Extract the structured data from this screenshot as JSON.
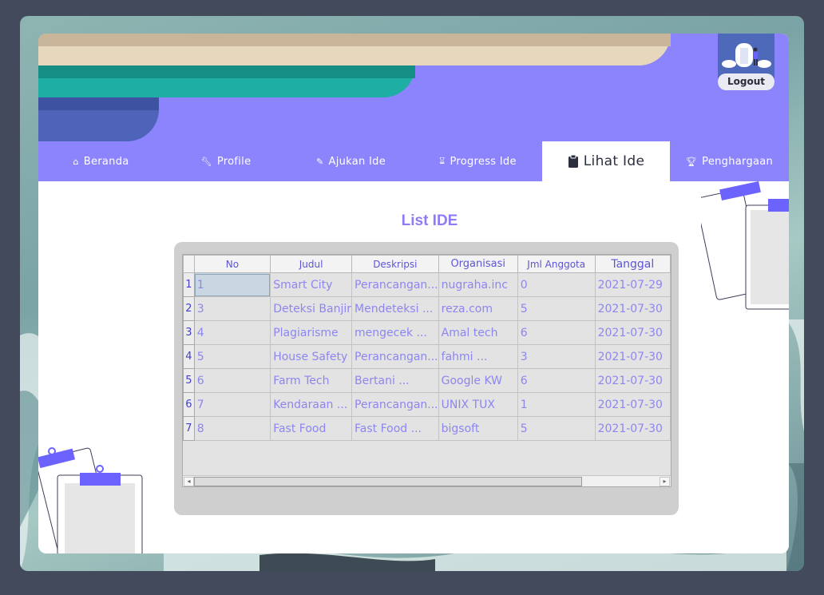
{
  "header": {
    "logout_label": "Logout"
  },
  "nav": {
    "items": [
      {
        "label": "Beranda",
        "icon": "home-icon"
      },
      {
        "label": "Profile",
        "icon": "wrench-icon"
      },
      {
        "label": "Ajukan Ide",
        "icon": "edit-icon"
      },
      {
        "label": "Progress Ide",
        "icon": "hourglass-icon"
      },
      {
        "label": "Lihat Ide",
        "icon": "clipboard-icon",
        "active": true
      },
      {
        "label": "Penghargaan",
        "icon": "trophy-icon"
      }
    ]
  },
  "main": {
    "title": "List IDE",
    "table": {
      "columns": [
        "No",
        "Judul",
        "Deskripsi",
        "Organisasi",
        "Jml Anggota",
        "Tanggal"
      ],
      "rows": [
        {
          "rownum": "1",
          "no": "1",
          "judul": "Smart City",
          "deskripsi": "Perancangan...",
          "organisasi": "nugraha.inc",
          "jml": "0",
          "tanggal": "2021-07-29"
        },
        {
          "rownum": "2",
          "no": "3",
          "judul": "Deteksi Banjir",
          "deskripsi": "Mendeteksi ...",
          "organisasi": "reza.com",
          "jml": "5",
          "tanggal": "2021-07-30"
        },
        {
          "rownum": "3",
          "no": "4",
          "judul": "Plagiarisme",
          "deskripsi": "mengecek ...",
          "organisasi": "Amal tech",
          "jml": "6",
          "tanggal": "2021-07-30"
        },
        {
          "rownum": "4",
          "no": "5",
          "judul": "House Safety",
          "deskripsi": "Perancangan...",
          "organisasi": "fahmi ...",
          "jml": "3",
          "tanggal": "2021-07-30"
        },
        {
          "rownum": "5",
          "no": "6",
          "judul": "Farm Tech",
          "deskripsi": "Bertani ...",
          "organisasi": "Google KW",
          "jml": "6",
          "tanggal": "2021-07-30"
        },
        {
          "rownum": "6",
          "no": "7",
          "judul": "Kendaraan ...",
          "deskripsi": "Perancangan...",
          "organisasi": "UNIX TUX",
          "jml": "1",
          "tanggal": "2021-07-30"
        },
        {
          "rownum": "7",
          "no": "8",
          "judul": "Fast Food",
          "deskripsi": "Fast Food ...",
          "organisasi": "bigsoft",
          "jml": "5",
          "tanggal": "2021-07-30"
        }
      ]
    }
  },
  "colors": {
    "header_purple": "#8c84fc",
    "accent_text": "#8d7cf6",
    "cell_text": "#8d86ef"
  }
}
